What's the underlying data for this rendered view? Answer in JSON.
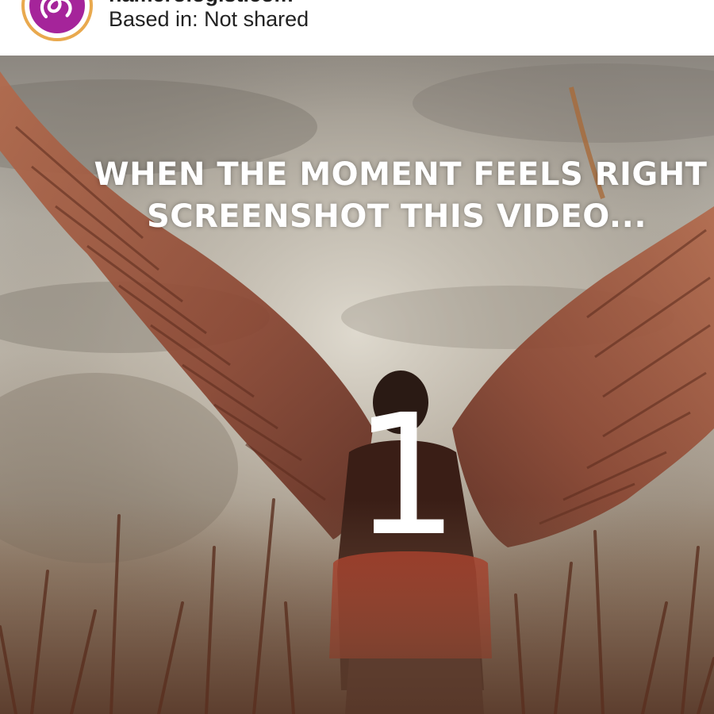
{
  "header": {
    "account_name": "namerologist.com",
    "based_in": "Based in: Not shared",
    "avatar_icon": "logo-icon",
    "avatar_ring_color": "#e9a94e",
    "avatar_fill_color": "#a5249a"
  },
  "video": {
    "caption_line1": "WHEN THE MOMENT FEELS RIGHT",
    "caption_line2": "SCREENSHOT THIS VIDEO...",
    "counter": "1",
    "caption_color": "#ffffff"
  }
}
